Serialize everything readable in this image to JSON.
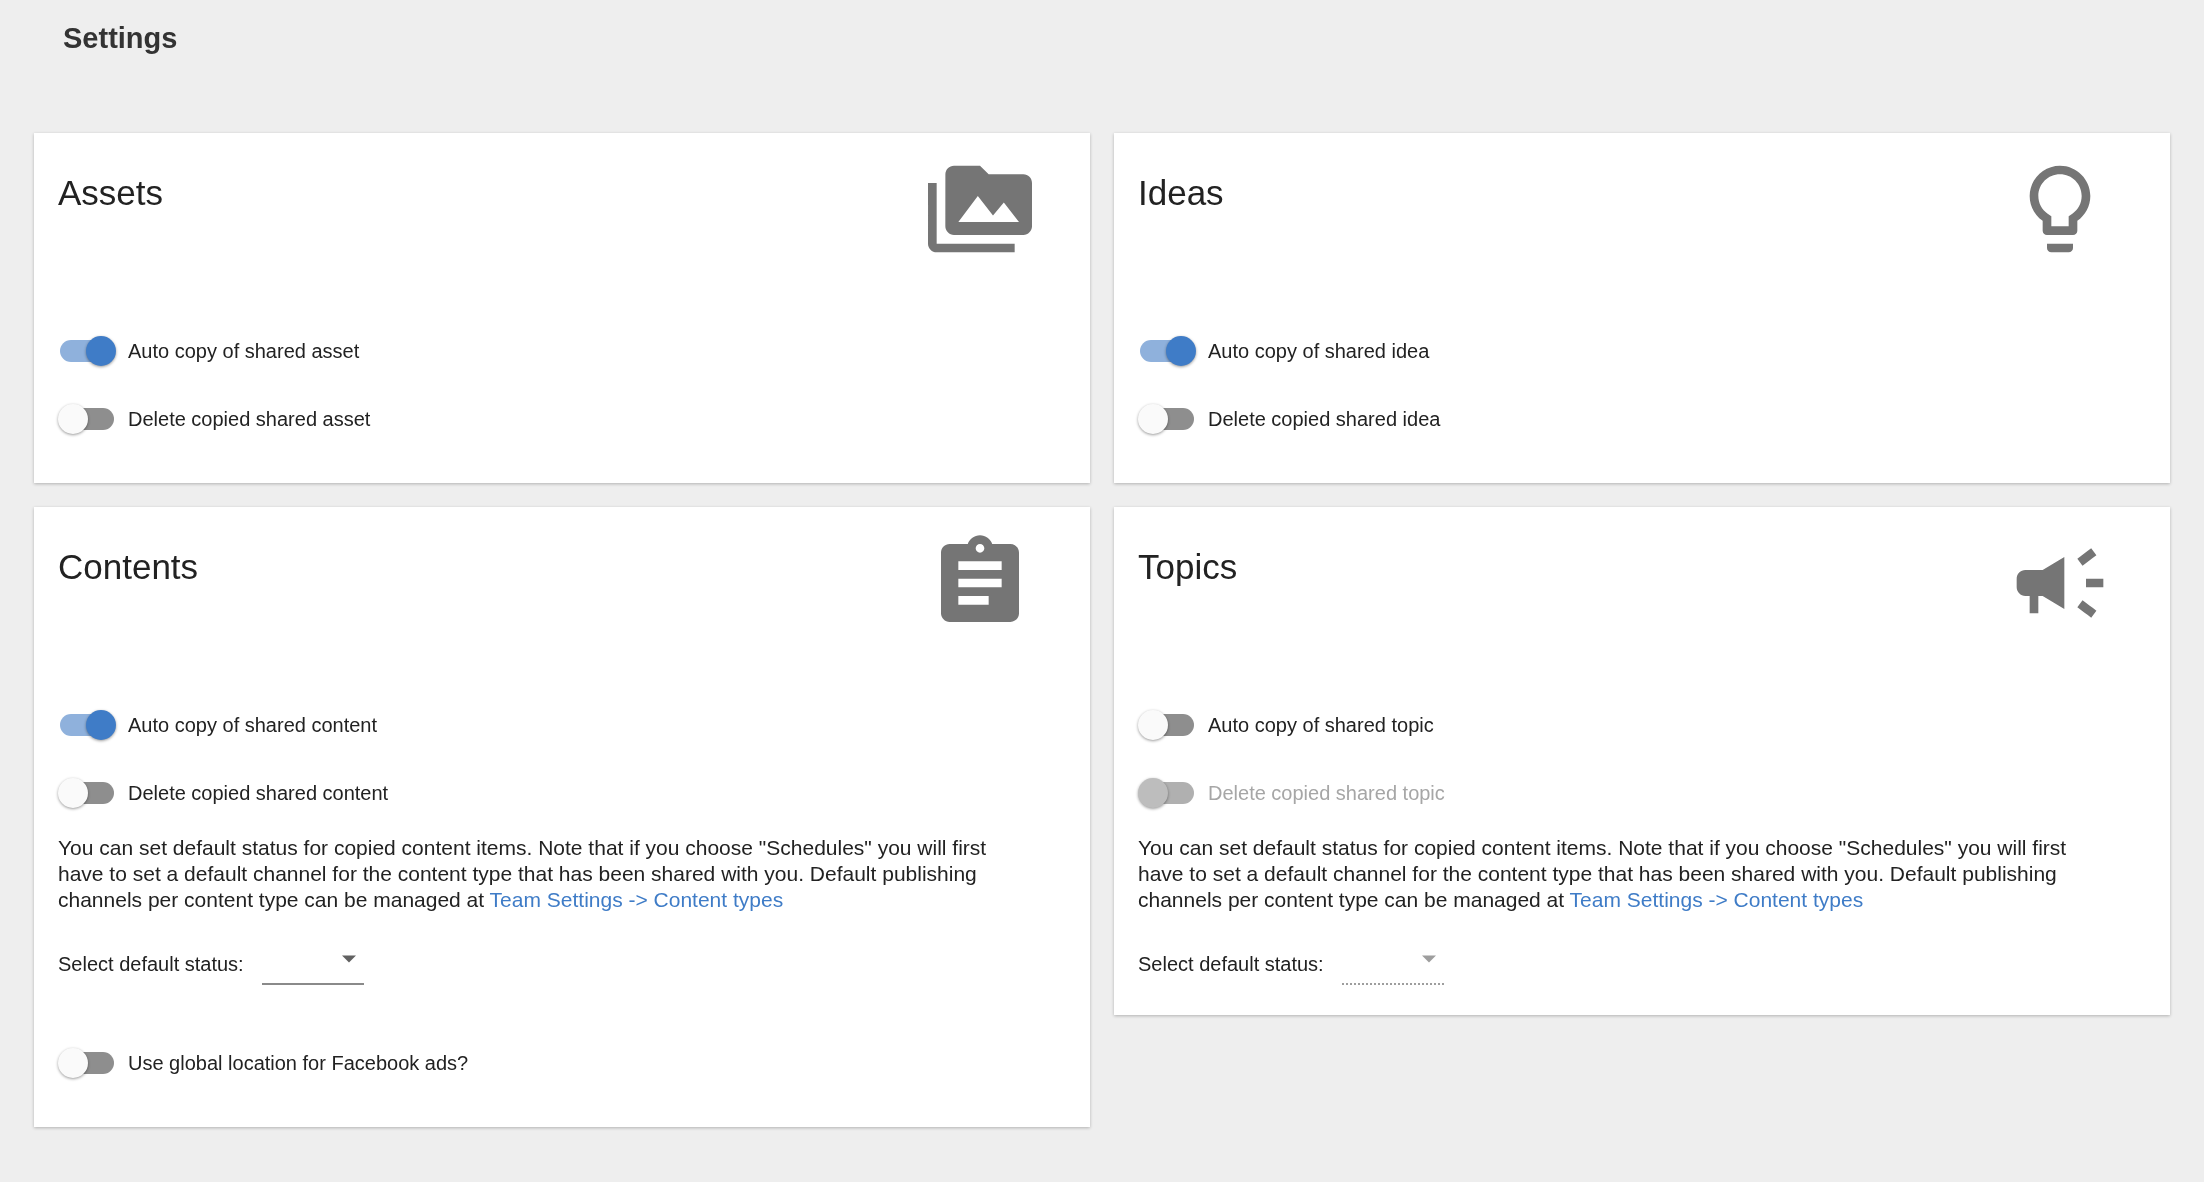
{
  "page": {
    "title": "Settings"
  },
  "cards": [
    {
      "kind": "media",
      "title": "Assets",
      "switches": [
        {
          "label": "Auto copy of shared asset",
          "on": true,
          "disabled": false
        },
        {
          "label": "Delete copied shared asset",
          "on": false,
          "disabled": false
        }
      ]
    },
    {
      "kind": "bulb",
      "title": "Ideas",
      "switches": [
        {
          "label": "Auto copy of shared idea",
          "on": true,
          "disabled": false
        },
        {
          "label": "Delete copied shared idea",
          "on": false,
          "disabled": false
        }
      ]
    },
    {
      "kind": "clipboard",
      "title": "Contents",
      "switches": [
        {
          "label": "Auto copy of shared content",
          "on": true,
          "disabled": false
        },
        {
          "label": "Delete copied shared content",
          "on": false,
          "disabled": false
        }
      ],
      "note": {
        "text": "You can set default status for copied content items. Note that if you choose \"Schedules\" you will first have to set a default channel for the content type that has been shared with you. Default publishing channels per content type can be managed at ",
        "link": "Team Settings -> Content types"
      },
      "select": {
        "label": "Select default status:",
        "disabled": false
      },
      "footer_switches": [
        {
          "label": "Use global location for Facebook ads?",
          "on": false,
          "disabled": false
        }
      ]
    },
    {
      "kind": "megaphone",
      "title": "Topics",
      "switches": [
        {
          "label": "Auto copy of shared topic",
          "on": false,
          "disabled": false
        },
        {
          "label": "Delete copied shared topic",
          "on": false,
          "disabled": true
        }
      ],
      "note": {
        "text": "You can set default status for copied content items. Note that if you choose \"Schedules\" you will first have to set a default channel for the content type that has been shared with you. Default publishing channels per content type can be managed at ",
        "link": "Team Settings -> Content types"
      },
      "select": {
        "label": "Select default status:",
        "disabled": true
      }
    }
  ]
}
